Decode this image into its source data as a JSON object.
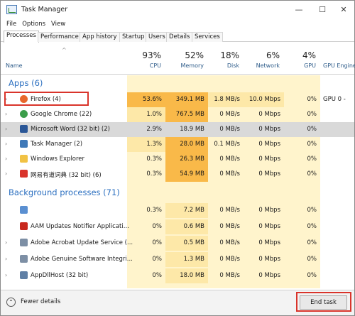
{
  "window": {
    "title": "Task Manager"
  },
  "menu": [
    "File",
    "Options",
    "View"
  ],
  "tabs": [
    "Processes",
    "Performance",
    "App history",
    "Startup",
    "Users",
    "Details",
    "Services"
  ],
  "header": {
    "name_label": "Name",
    "cpu": {
      "pct": "93%",
      "label": "CPU"
    },
    "memory": {
      "pct": "52%",
      "label": "Memory"
    },
    "disk": {
      "pct": "18%",
      "label": "Disk"
    },
    "network": {
      "pct": "6%",
      "label": "Network"
    },
    "gpu": {
      "pct": "4%",
      "label": "GPU"
    },
    "gpu_engine": {
      "label": "GPU Engine"
    }
  },
  "groups": {
    "apps": "Apps (6)",
    "background": "Background processes (71)"
  },
  "apps": [
    {
      "name": "Firefox (4)",
      "cpu": "53.6%",
      "mem": "349.1 MB",
      "disk": "1.8 MB/s",
      "net": "10.0 Mbps",
      "gpu": "0%",
      "gpu_engine": "GPU 0 -",
      "icon": "firefox-icon"
    },
    {
      "name": "Google Chrome (22)",
      "cpu": "1.0%",
      "mem": "767.5 MB",
      "disk": "0 MB/s",
      "net": "0 Mbps",
      "gpu": "0%",
      "gpu_engine": "",
      "icon": "chrome-icon"
    },
    {
      "name": "Microsoft Word (32 bit) (2)",
      "cpu": "2.9%",
      "mem": "18.9 MB",
      "disk": "0 MB/s",
      "net": "0 Mbps",
      "gpu": "0%",
      "gpu_engine": "",
      "icon": "word-icon"
    },
    {
      "name": "Task Manager (2)",
      "cpu": "1.3%",
      "mem": "28.0 MB",
      "disk": "0.1 MB/s",
      "net": "0 Mbps",
      "gpu": "0%",
      "gpu_engine": "",
      "icon": "task-manager-icon"
    },
    {
      "name": "Windows Explorer",
      "cpu": "0.3%",
      "mem": "26.3 MB",
      "disk": "0 MB/s",
      "net": "0 Mbps",
      "gpu": "0%",
      "gpu_engine": "",
      "icon": "folder-icon"
    },
    {
      "name": "网易有道词典 (32 bit) (6)",
      "cpu": "0.3%",
      "mem": "54.9 MB",
      "disk": "0 MB/s",
      "net": "0 Mbps",
      "gpu": "0%",
      "gpu_engine": "",
      "icon": "youdao-icon"
    }
  ],
  "background": [
    {
      "name": "",
      "cpu": "0.3%",
      "mem": "7.2 MB",
      "disk": "0 MB/s",
      "net": "0 Mbps",
      "gpu": "0%",
      "icon": "gear-icon"
    },
    {
      "name": "AAM Updates Notifier Applicati...",
      "cpu": "0%",
      "mem": "0.6 MB",
      "disk": "0 MB/s",
      "net": "0 Mbps",
      "gpu": "0%",
      "icon": "adobe-icon"
    },
    {
      "name": "Adobe Acrobat Update Service (...",
      "cpu": "0%",
      "mem": "0.5 MB",
      "disk": "0 MB/s",
      "net": "0 Mbps",
      "gpu": "0%",
      "icon": "service-icon"
    },
    {
      "name": "Adobe Genuine Software Integri...",
      "cpu": "0%",
      "mem": "1.3 MB",
      "disk": "0 MB/s",
      "net": "0 Mbps",
      "gpu": "0%",
      "icon": "service-icon"
    },
    {
      "name": "AppDllHost (32 bit)",
      "cpu": "0%",
      "mem": "18.0 MB",
      "disk": "0 MB/s",
      "net": "0 Mbps",
      "gpu": "0%",
      "icon": "window-icon"
    }
  ],
  "footer": {
    "fewer_details": "Fewer details",
    "end_task": "End task"
  },
  "colors": {
    "heat_high": "#f9b949",
    "heat_mid": "#fde8a8",
    "heat_low": "#fff4cc",
    "group_title": "#2b6fc0",
    "highlight": "#d9342b"
  }
}
